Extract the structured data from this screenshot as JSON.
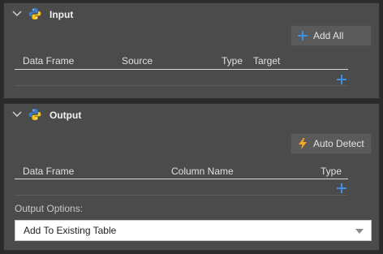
{
  "input": {
    "title": "Input",
    "add_all_label": "Add All",
    "columns": [
      "Data Frame",
      "Source",
      "Type",
      "Target"
    ],
    "icons": {
      "collapse": "chevron-down-icon",
      "logo": "python-icon",
      "add_all": "plus-icon",
      "add_row": "plus-icon"
    }
  },
  "output": {
    "title": "Output",
    "auto_detect_label": "Auto Detect",
    "columns": [
      "Data Frame",
      "Column Name",
      "Type"
    ],
    "options_label": "Output Options:",
    "options_value": "Add To Existing Table",
    "icons": {
      "collapse": "chevron-down-icon",
      "logo": "python-icon",
      "auto_detect": "lightning-icon",
      "add_row": "plus-icon",
      "dropdown": "caret-down-icon"
    }
  },
  "colors": {
    "panel_bg": "#4b4b4b",
    "accent_blue": "#3d8fe0",
    "accent_orange": "#f5a623",
    "select_bg": "#ffffff"
  }
}
